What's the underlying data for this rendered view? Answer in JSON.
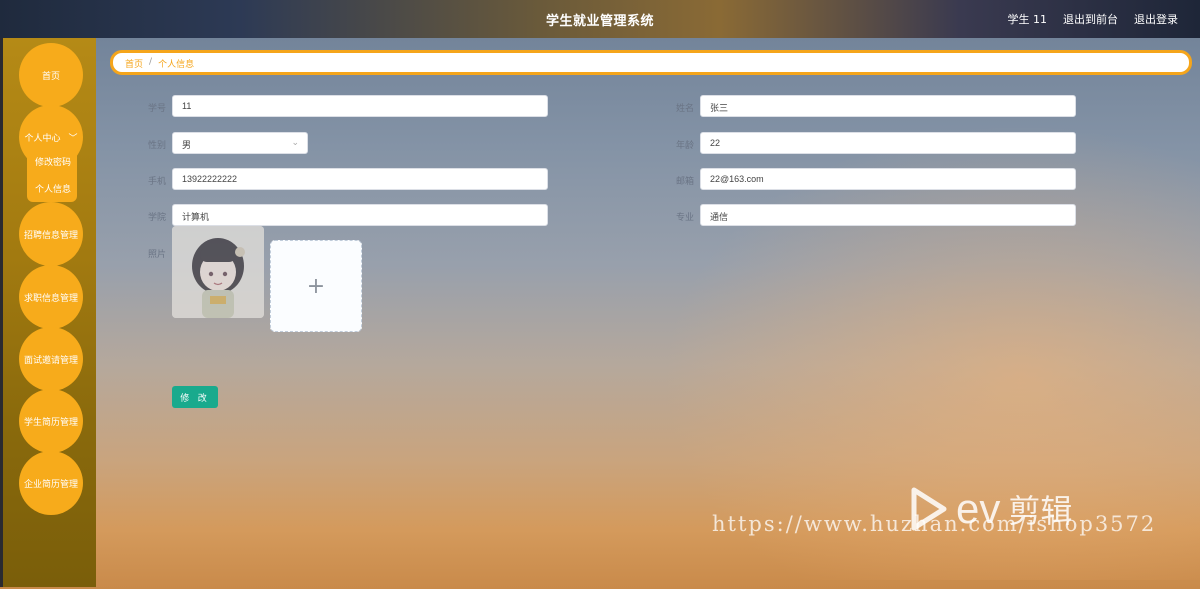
{
  "header": {
    "title": "学生就业管理系统",
    "user": "学生 11",
    "back_label": "退出到前台",
    "logout_label": "退出登录"
  },
  "sidebar": {
    "items": [
      {
        "label": "首页"
      },
      {
        "label": "个人中心"
      },
      {
        "label": "招聘信息管理"
      },
      {
        "label": "求职信息管理"
      },
      {
        "label": "面试邀请管理"
      },
      {
        "label": "学生简历管理"
      },
      {
        "label": "企业简历管理"
      }
    ],
    "submenu": [
      {
        "label": "修改密码"
      },
      {
        "label": "个人信息"
      }
    ]
  },
  "breadcrumb": {
    "home": "首页",
    "separator": "/",
    "current": "个人信息"
  },
  "form": {
    "xuehao": {
      "label": "学号",
      "value": "11"
    },
    "xingming": {
      "label": "姓名",
      "value": "张三"
    },
    "xingbie": {
      "label": "性别",
      "value": "男"
    },
    "nianling": {
      "label": "年龄",
      "value": "22"
    },
    "shouji": {
      "label": "手机",
      "value": "13922222222"
    },
    "youxiang": {
      "label": "邮箱",
      "value": "22@163.com"
    },
    "xueyuan": {
      "label": "学院",
      "value": "计算机"
    },
    "zhuanye": {
      "label": "专业",
      "value": "通信"
    },
    "zhaopian": {
      "label": "照片"
    },
    "upload_plus": "+",
    "submit_label": "修 改"
  },
  "watermark": {
    "url": "https://www.huzhan.com/ishop3572",
    "logo_ev": "ev",
    "logo_cn": "剪辑"
  },
  "colors": {
    "accent": "#f7ab1b",
    "primary_button": "#19aa8d"
  }
}
